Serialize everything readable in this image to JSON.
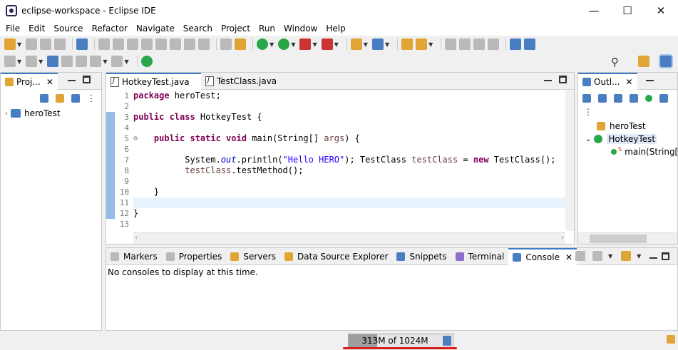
{
  "window": {
    "title": "eclipse-workspace - Eclipse IDE",
    "minimize": "—",
    "maximize": "☐",
    "close": "✕"
  },
  "menu": [
    "File",
    "Edit",
    "Source",
    "Refactor",
    "Navigate",
    "Search",
    "Project",
    "Run",
    "Window",
    "Help"
  ],
  "project_explorer": {
    "tab": "Proj...",
    "items": [
      {
        "label": "heroTest"
      }
    ]
  },
  "editor": {
    "tabs": [
      {
        "label": "HotkeyTest.java",
        "active": true
      },
      {
        "label": "TestClass.java",
        "active": false
      }
    ],
    "line_numbers": [
      "1",
      "2",
      "3",
      "4",
      "5",
      "6",
      "7",
      "8",
      "9",
      "10",
      "11",
      "12",
      "13"
    ],
    "fold_marker": "⊖"
  },
  "outline": {
    "tab": "Outl...",
    "items": [
      {
        "label": "heroTest"
      },
      {
        "label": "HotkeyTest"
      },
      {
        "label": "main(String[]"
      }
    ],
    "static_marker": "S"
  },
  "bottom_tabs": [
    {
      "label": "Markers"
    },
    {
      "label": "Properties"
    },
    {
      "label": "Servers"
    },
    {
      "label": "Data Source Explorer"
    },
    {
      "label": "Snippets"
    },
    {
      "label": "Terminal"
    },
    {
      "label": "Console",
      "active": true
    }
  ],
  "console": {
    "message": "No consoles to display at this time."
  },
  "status": {
    "heap": "313M of 1024M",
    "heap_used_fraction": 0.31
  },
  "colors": {
    "keyword": "#7f0055",
    "string": "#2a00ff",
    "field": "#0000c0",
    "accent": "#3d7cc2",
    "heap_underline": "#d62020"
  }
}
